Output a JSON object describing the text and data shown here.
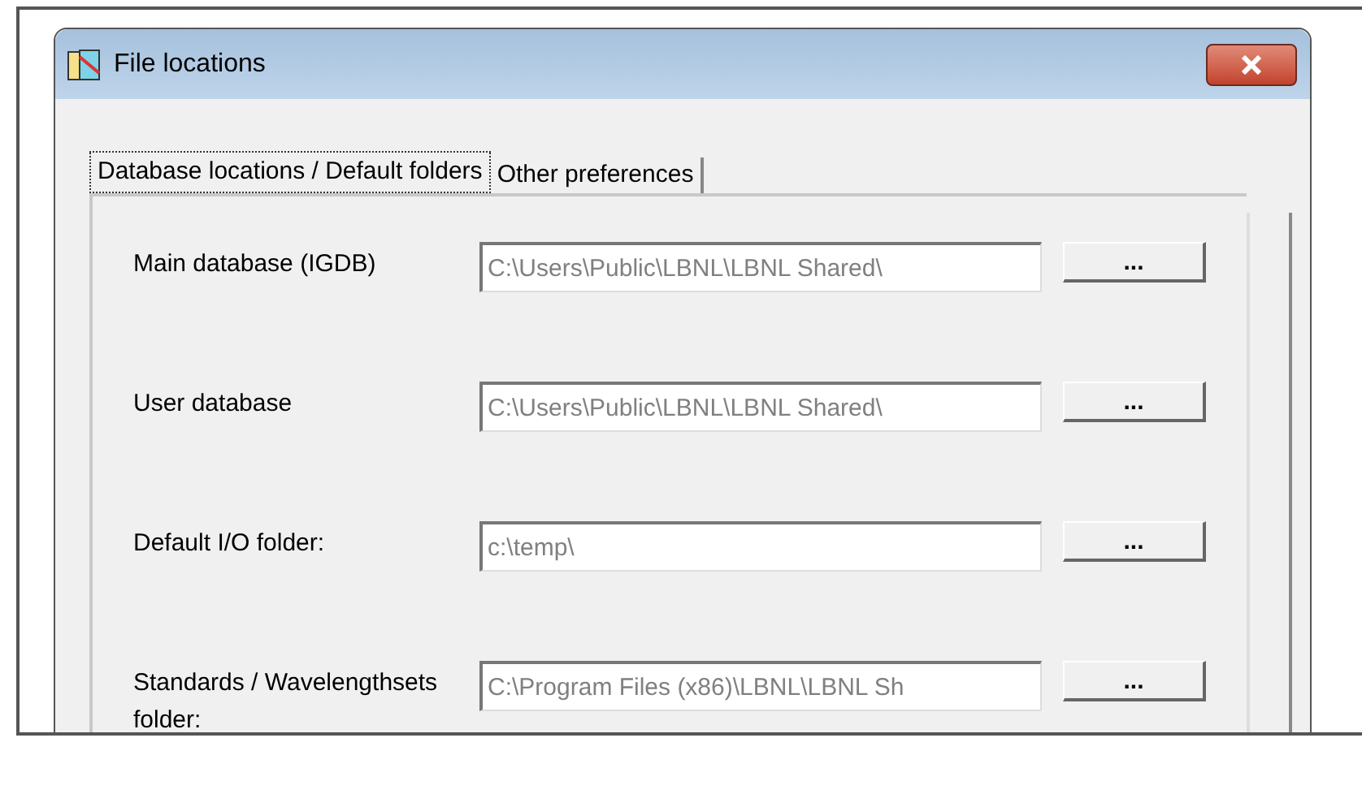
{
  "window": {
    "title": "File locations"
  },
  "tabs": [
    {
      "label": "Database locations / Default folders",
      "selected": true
    },
    {
      "label": "Other preferences",
      "selected": false
    }
  ],
  "rows": [
    {
      "label": "Main database (IGDB)",
      "value": "C:\\Users\\Public\\LBNL\\LBNL Shared\\",
      "button": "..."
    },
    {
      "label": "User database",
      "value": "C:\\Users\\Public\\LBNL\\LBNL Shared\\",
      "button": "..."
    },
    {
      "label": "Default I/O folder:",
      "value": "c:\\temp\\",
      "button": "..."
    },
    {
      "label": "Standards / Wavelengthsets folder:",
      "value": "C:\\Program Files (x86)\\LBNL\\LBNL Sh",
      "button": "..."
    }
  ]
}
